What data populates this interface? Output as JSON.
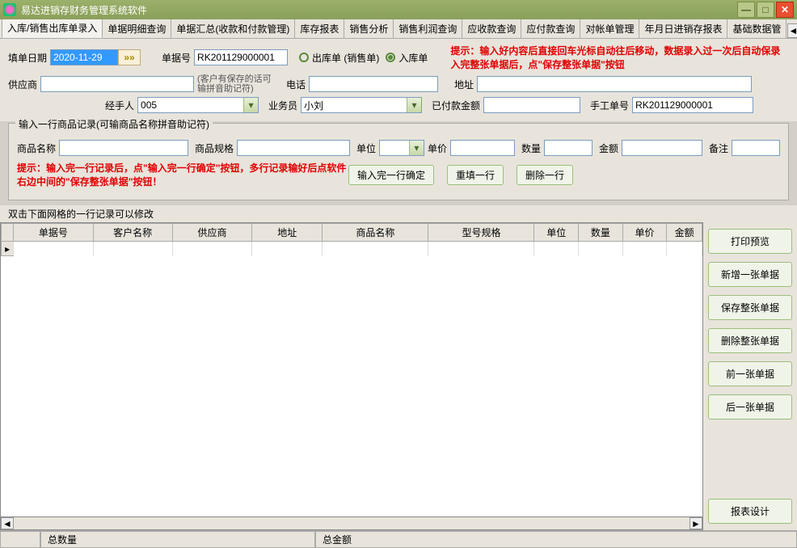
{
  "window": {
    "title": "易达进销存财务管理系统软件"
  },
  "tabs": [
    "入库/销售出库单录入",
    "单据明细查询",
    "单据汇总(收款和付款管理)",
    "库存报表",
    "销售分析",
    "销售利润查询",
    "应收款查询",
    "应付款查询",
    "对帐单管理",
    "年月日进销存报表",
    "基础数据管"
  ],
  "form": {
    "date_label": "填单日期",
    "date_value": "2020-11-29",
    "docno_label": "单据号",
    "docno_value": "RK201129000001",
    "radio_out": "出库单 (销售单)",
    "radio_in": "入库单",
    "hint_top": "提示：输入好内容后直接回车光标自动往后移动，数据录入过一次后自动保录入完整张单据后，点\"保存整张单据\"按钮",
    "supplier_label": "供应商",
    "supplier_hint": "(客户有保存的话可输拼音助记符)",
    "phone_label": "电话",
    "address_label": "地址",
    "handler_label": "经手人",
    "handler_value": "005",
    "clerk_label": "业务员",
    "clerk_value": "小刘",
    "paid_label": "已付款金额",
    "manual_label": "手工单号",
    "manual_value": "RK201129000001"
  },
  "itemset": {
    "legend": "输入一行商品记录(可输商品名称拼音助记符)",
    "name_label": "商品名称",
    "spec_label": "商品规格",
    "unit_label": "单位",
    "price_label": "单价",
    "qty_label": "数量",
    "amount_label": "金额",
    "remark_label": "备注",
    "hint": "提示：输入完一行记录后，点\"输入完一行确定\"按钮，多行记录输好后点软件右边中间的\"保存整张单据\"按钮！",
    "btn_confirm": "输入完一行确定",
    "btn_reset": "重填一行",
    "btn_delete": "删除一行"
  },
  "grid": {
    "label": "双击下面网格的一行记录可以修改",
    "columns": [
      "单据号",
      "客户名称",
      "供应商",
      "地址",
      "商品名称",
      "型号规格",
      "单位",
      "数量",
      "单价",
      "金额"
    ]
  },
  "sidebar": {
    "preview": "打印预览",
    "new": "新增一张单据",
    "save": "保存整张单据",
    "delete": "删除整张单据",
    "prev": "前一张单据",
    "next": "后一张单据",
    "report": "报表设计"
  },
  "footer": {
    "total_qty": "总数量",
    "total_amt": "总金额"
  }
}
